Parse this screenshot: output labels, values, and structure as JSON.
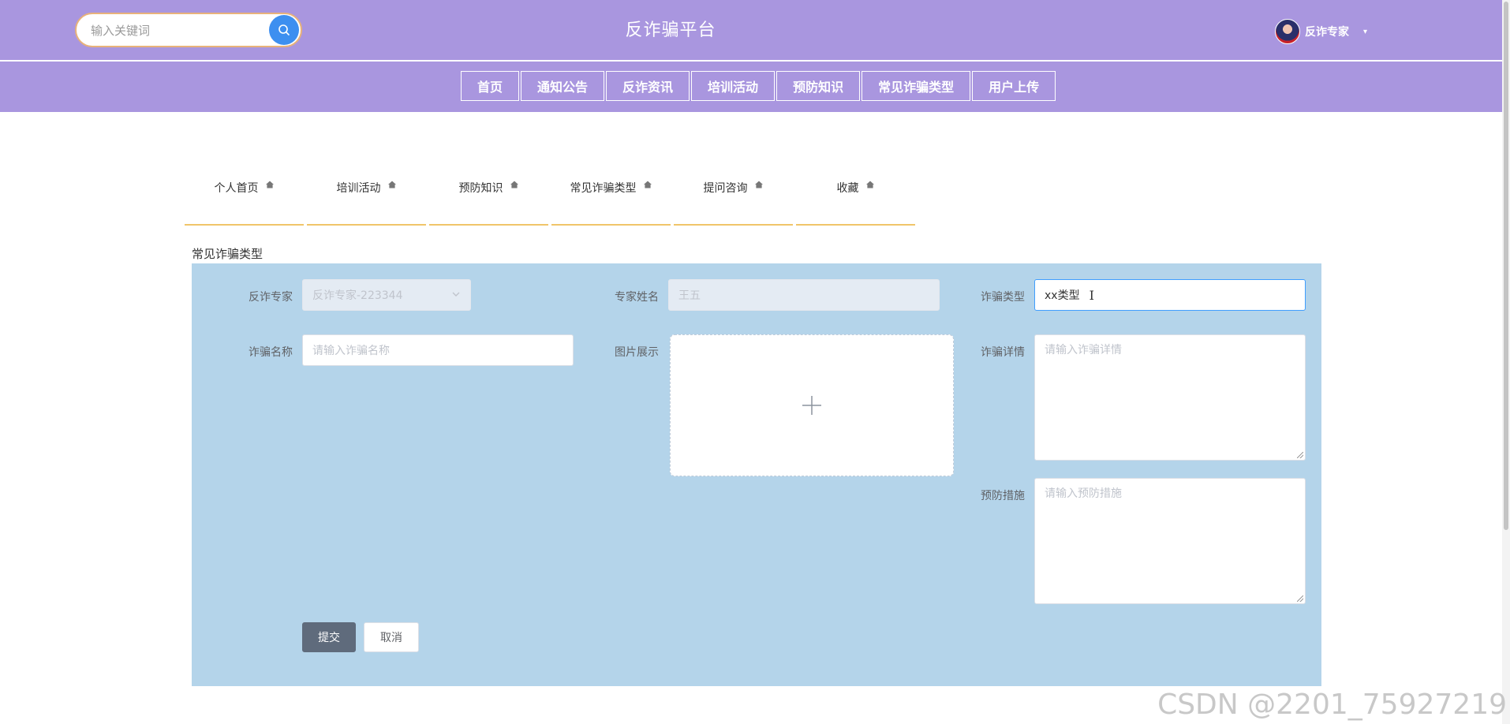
{
  "header": {
    "search_placeholder": "输入关键词",
    "title": "反诈骗平台",
    "user": {
      "name": "反诈专家",
      "caret": "▾"
    }
  },
  "nav": {
    "items": [
      {
        "label": "首页"
      },
      {
        "label": "通知公告"
      },
      {
        "label": "反诈资讯"
      },
      {
        "label": "培训活动"
      },
      {
        "label": "预防知识"
      },
      {
        "label": "常见诈骗类型"
      },
      {
        "label": "用户上传"
      }
    ]
  },
  "subnav": {
    "items": [
      {
        "label": "个人首页"
      },
      {
        "label": "培训活动"
      },
      {
        "label": "预防知识"
      },
      {
        "label": "常见诈骗类型"
      },
      {
        "label": "提问咨询"
      },
      {
        "label": "收藏"
      }
    ]
  },
  "section_title": "常见诈骗类型",
  "form": {
    "expert": {
      "label": "反诈专家",
      "value": "反诈专家-223344"
    },
    "expert_name": {
      "label": "专家姓名",
      "value": "王五"
    },
    "fraud_type": {
      "label": "诈骗类型",
      "value": "xx类型"
    },
    "fraud_name": {
      "label": "诈骗名称",
      "placeholder": "请输入诈骗名称"
    },
    "image": {
      "label": "图片展示"
    },
    "fraud_detail": {
      "label": "诈骗详情",
      "placeholder": "请输入诈骗详情"
    },
    "prevention": {
      "label": "预防措施",
      "placeholder": "请输入预防措施"
    },
    "submit_label": "提交",
    "cancel_label": "取消"
  },
  "watermark": "CSDN @2201_75927219",
  "colors": {
    "header_bg": "#a996df",
    "panel_bg": "#b4d4ea",
    "search_button": "#3d8ff0",
    "submit_button": "#5f6b7c",
    "subnav_underline": "#f0c56a"
  },
  "icons": {
    "search": "magnifier-icon",
    "home": "home-icon",
    "plus": "plus-icon",
    "dropdown": "chevron-down-icon"
  }
}
